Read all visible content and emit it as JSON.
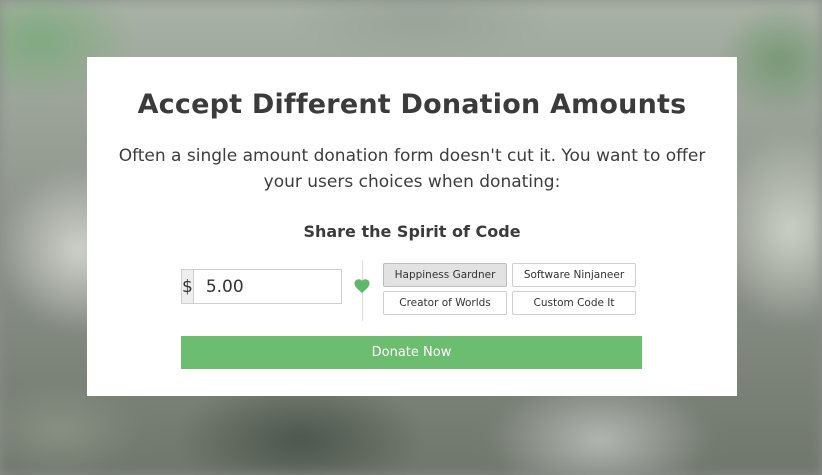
{
  "page": {
    "title": "Accept Different Donation Amounts",
    "description": "Often a single amount donation form doesn't cut it. You want to offer your users choices when donating:"
  },
  "form": {
    "title": "Share the Spirit of Code",
    "currency_symbol": "$",
    "amount_value": "5.00",
    "heart_icon": "heart-icon",
    "accent_color": "#6cbd6f",
    "levels": [
      {
        "label": "Happiness Gardner",
        "selected": true
      },
      {
        "label": "Software Ninjaneer",
        "selected": false
      },
      {
        "label": "Creator of Worlds",
        "selected": false
      },
      {
        "label": "Custom Code It",
        "selected": false
      }
    ],
    "donate_label": "Donate Now"
  }
}
